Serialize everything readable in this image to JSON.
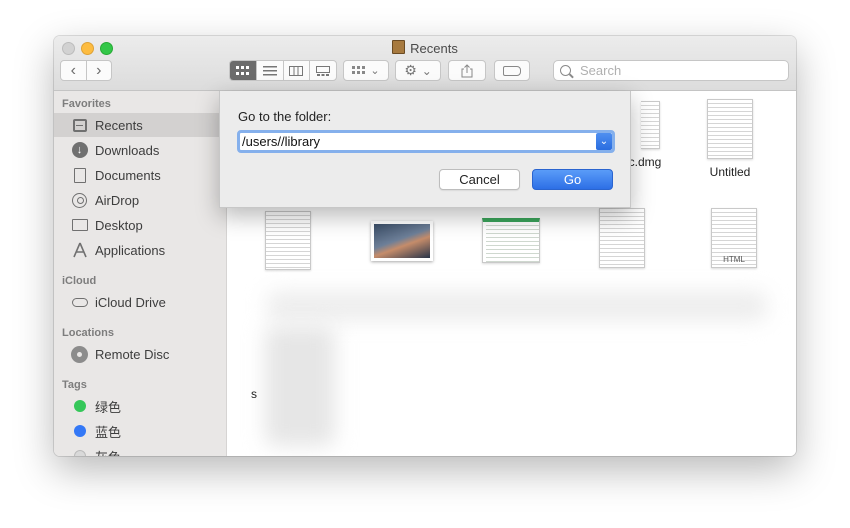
{
  "window": {
    "title": "Recents"
  },
  "toolbar": {
    "back_glyph": "‹",
    "forward_glyph": "›",
    "search_placeholder": "Search"
  },
  "sidebar": {
    "favorites_header": "Favorites",
    "favorites": [
      {
        "label": "Recents",
        "icon": "clock-icon",
        "selected": true
      },
      {
        "label": "Downloads",
        "icon": "download-icon"
      },
      {
        "label": "Documents",
        "icon": "document-icon"
      },
      {
        "label": "AirDrop",
        "icon": "airdrop-icon"
      },
      {
        "label": "Desktop",
        "icon": "desktop-icon"
      },
      {
        "label": "Applications",
        "icon": "applications-icon"
      }
    ],
    "icloud_header": "iCloud",
    "icloud": [
      {
        "label": "iCloud Drive",
        "icon": "cloud-icon"
      }
    ],
    "locations_header": "Locations",
    "locations": [
      {
        "label": "Remote Disc",
        "icon": "disc-icon"
      }
    ],
    "tags_header": "Tags",
    "tags": [
      {
        "label": "绿色",
        "color": "#35c759"
      },
      {
        "label": "蓝色",
        "color": "#3478f6"
      },
      {
        "label": "灰色",
        "color": "#d9d9d9"
      }
    ]
  },
  "files": {
    "row1": [
      {
        "label": "ac.dmg"
      },
      {
        "label": "Untitled"
      }
    ],
    "html_badge": "HTML",
    "partial_label": "s"
  },
  "dialog": {
    "prompt": "Go to the folder:",
    "path_value": "/users//library",
    "cancel_label": "Cancel",
    "go_label": "Go"
  },
  "colors": {
    "accent": "#2d6fe6",
    "sidebar_bg": "#e9e7e6"
  }
}
